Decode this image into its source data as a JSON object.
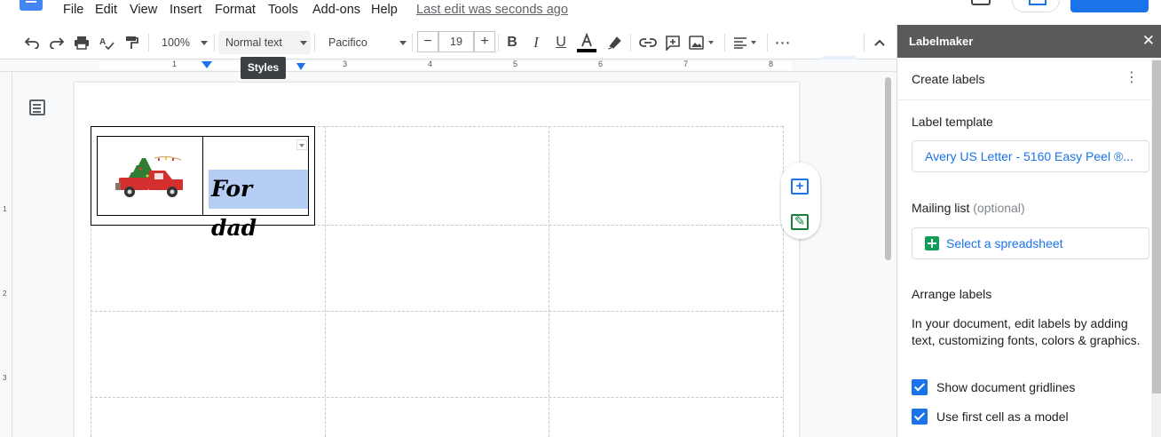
{
  "menu": {
    "items": [
      "File",
      "Edit",
      "View",
      "Insert",
      "Format",
      "Tools",
      "Add-ons",
      "Help"
    ],
    "last_edit": "Last edit was seconds ago"
  },
  "toolbar": {
    "zoom": "100%",
    "style": "Normal text",
    "font": "Pacifico",
    "font_size": "19",
    "minus": "−",
    "plus": "+",
    "tooltip": "Styles"
  },
  "ruler": {
    "numbers": [
      "1",
      "3",
      "4",
      "5",
      "6",
      "7",
      "8"
    ]
  },
  "vruler": {
    "numbers": [
      "1",
      "2",
      "3"
    ]
  },
  "document": {
    "label_text": "For dad"
  },
  "sidebar": {
    "title": "Labelmaker",
    "close": "✕",
    "create_labels": "Create labels",
    "label_template_heading": "Label template",
    "label_template_value": "Avery US Letter - 5160 Easy Peel ®...",
    "mailing_list_heading": "Mailing list",
    "mailing_list_optional": "(optional)",
    "select_spreadsheet": "Select a spreadsheet",
    "arrange_heading": "Arrange labels",
    "arrange_desc": "In your document, edit labels by adding text, customizing fonts, colors & graphics.",
    "show_gridlines": "Show document gridlines",
    "use_first_cell": "Use first cell as a model"
  }
}
